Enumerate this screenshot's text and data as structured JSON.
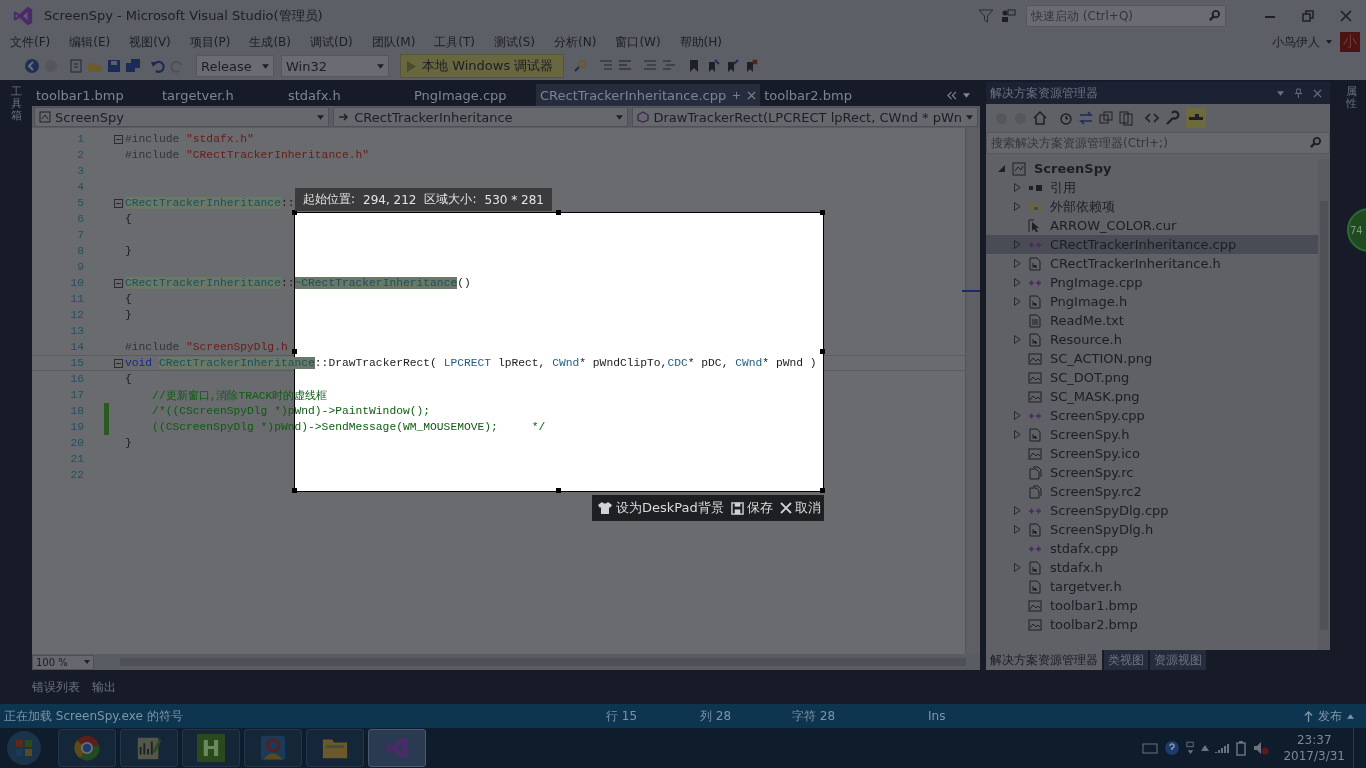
{
  "window": {
    "title": "ScreenSpy - Microsoft Visual Studio(管理员)",
    "quick_launch": {
      "placeholder": "快速启动 (Ctrl+Q)"
    },
    "user": "小鸟伊人",
    "avatar": "小"
  },
  "menu": [
    "文件(F)",
    "编辑(E)",
    "视图(V)",
    "项目(P)",
    "生成(B)",
    "调试(D)",
    "团队(M)",
    "工具(T)",
    "测试(S)",
    "分析(N)",
    "窗口(W)",
    "帮助(H)"
  ],
  "toolbar": {
    "configuration": "Release",
    "platform": "Win32",
    "debugger": "本地 Windows 调试器"
  },
  "left_strip": "工具箱",
  "right_strip": "属性",
  "tabs": [
    {
      "label": "toolbar1.bmp",
      "selected": false
    },
    {
      "label": "targetver.h",
      "selected": false
    },
    {
      "label": "stdafx.h",
      "selected": false
    },
    {
      "label": "PngImage.cpp",
      "selected": false
    },
    {
      "label": "CRectTrackerInheritance.cpp",
      "selected": true
    },
    {
      "label": "toolbar2.bmp",
      "selected": false
    }
  ],
  "nav": [
    "ScreenSpy",
    "CRectTrackerInheritance",
    "DrawTrackerRect(LPCRECT lpRect, CWnd * pWn"
  ],
  "code": [
    {
      "n": "1",
      "fold": true,
      "changed": false,
      "current": false,
      "segs": [
        {
          "kind": "pp",
          "text": "#include "
        },
        {
          "kind": "str",
          "text": "\"stdafx.h\""
        }
      ]
    },
    {
      "n": "2",
      "fold": false,
      "changed": false,
      "current": false,
      "segs": [
        {
          "kind": "pp",
          "text": "#include "
        },
        {
          "kind": "str",
          "text": "\"CRectTrackerInheritance.h\""
        }
      ]
    },
    {
      "n": "3",
      "fold": false,
      "changed": false,
      "current": false
    },
    {
      "n": "4",
      "fold": false,
      "changed": false,
      "current": false
    },
    {
      "n": "5",
      "fold": true,
      "changed": false,
      "current": false,
      "segs": [
        {
          "kind": "ref",
          "text": "CRectTrackerInheritance"
        },
        {
          "kind": "plain",
          "text": "::"
        }
      ]
    },
    {
      "n": "6",
      "fold": false,
      "changed": false,
      "current": false,
      "segs": [
        {
          "kind": "plain",
          "text": "{"
        }
      ]
    },
    {
      "n": "7",
      "fold": false,
      "changed": false,
      "current": false
    },
    {
      "n": "8",
      "fold": false,
      "changed": false,
      "current": false,
      "segs": [
        {
          "kind": "plain",
          "text": "}"
        }
      ]
    },
    {
      "n": "9",
      "fold": false,
      "changed": false,
      "current": false
    },
    {
      "n": "10",
      "fold": true,
      "changed": false,
      "current": false,
      "segs": [
        {
          "kind": "ref",
          "text": "CRectTrackerInheritance"
        },
        {
          "kind": "plain",
          "text": "::"
        },
        {
          "kind": "ref",
          "text": "~CRectTrackerInheritance"
        },
        {
          "kind": "plain",
          "text": "()"
        }
      ]
    },
    {
      "n": "11",
      "fold": false,
      "changed": false,
      "current": false,
      "segs": [
        {
          "kind": "plain",
          "text": "{"
        }
      ]
    },
    {
      "n": "12",
      "fold": false,
      "changed": false,
      "current": false,
      "segs": [
        {
          "kind": "plain",
          "text": "}"
        }
      ]
    },
    {
      "n": "13",
      "fold": false,
      "changed": false,
      "current": false
    },
    {
      "n": "14",
      "fold": false,
      "changed": false,
      "current": false,
      "segs": [
        {
          "kind": "pp",
          "text": "#include "
        },
        {
          "kind": "str",
          "text": "\"ScreenSpyDlg.h"
        }
      ]
    },
    {
      "n": "15",
      "fold": true,
      "changed": false,
      "current": true,
      "segs": [
        {
          "kind": "kw",
          "text": "void "
        },
        {
          "kind": "ref",
          "text": "CRectTrackerInheritance"
        },
        {
          "kind": "plain",
          "text": "::DrawTrackerRect( "
        },
        {
          "kind": "type",
          "text": "LPCRECT"
        },
        {
          "kind": "plain",
          "text": " lpRect, "
        },
        {
          "kind": "type",
          "text": "CWnd"
        },
        {
          "kind": "plain",
          "text": "* pWndClipTo,"
        },
        {
          "kind": "type",
          "text": "CDC"
        },
        {
          "kind": "plain",
          "text": "* pDC, "
        },
        {
          "kind": "type",
          "text": "CWnd"
        },
        {
          "kind": "plain",
          "text": "* pWnd )"
        }
      ]
    },
    {
      "n": "16",
      "fold": false,
      "changed": false,
      "current": false,
      "segs": [
        {
          "kind": "plain",
          "text": "{"
        }
      ]
    },
    {
      "n": "17",
      "fold": false,
      "changed": false,
      "current": false,
      "segs": [
        {
          "kind": "cm",
          "text": "    //更新窗口,消除TRACK时的虚线框"
        }
      ]
    },
    {
      "n": "18",
      "fold": false,
      "changed": true,
      "current": false,
      "segs": [
        {
          "kind": "cm",
          "text": "    /*((CScreenSpyDlg *)pWnd)->PaintWindow();"
        }
      ]
    },
    {
      "n": "19",
      "fold": false,
      "changed": true,
      "current": false,
      "segs": [
        {
          "kind": "cm",
          "text": "    ((CScreenSpyDlg *)pWnd)->SendMessage(WM_MOUSEMOVE);     */"
        }
      ]
    },
    {
      "n": "20",
      "fold": false,
      "changed": false,
      "current": false,
      "segs": [
        {
          "kind": "plain",
          "text": "}"
        }
      ]
    },
    {
      "n": "21",
      "fold": false,
      "changed": false,
      "current": false
    },
    {
      "n": "22",
      "fold": false,
      "changed": false,
      "current": false
    }
  ],
  "capture": {
    "start_label": "起始位置:",
    "start": "294, 212",
    "size_label": "区域大小:",
    "size": "530 * 281",
    "actions": [
      {
        "kind": "wallpaper",
        "label": "设为DeskPad背景"
      },
      {
        "kind": "save",
        "label": "保存"
      },
      {
        "kind": "cancel",
        "label": "取消"
      }
    ]
  },
  "zoom": "100 %",
  "solution_explorer": {
    "title": "解决方案资源管理器",
    "search": {
      "placeholder": "搜索解决方案资源管理器(Ctrl+;)"
    },
    "root": {
      "label": "ScreenSpy",
      "expanded": true
    },
    "items": [
      {
        "label": "引用",
        "kind": "ref",
        "expandable": true,
        "selected": false
      },
      {
        "label": "外部依赖项",
        "kind": "deps",
        "expandable": true,
        "selected": false
      },
      {
        "label": "ARROW_COLOR.cur",
        "kind": "cursor",
        "expandable": false,
        "selected": false
      },
      {
        "label": "CRectTrackerInheritance.cpp",
        "kind": "cpp",
        "expandable": true,
        "selected": true
      },
      {
        "label": "CRectTrackerInheritance.h",
        "kind": "h",
        "expandable": true,
        "selected": false
      },
      {
        "label": "PngImage.cpp",
        "kind": "cpp",
        "expandable": true,
        "selected": false
      },
      {
        "label": "PngImage.h",
        "kind": "h",
        "expandable": true,
        "selected": false
      },
      {
        "label": "ReadMe.txt",
        "kind": "txt",
        "expandable": false,
        "selected": false
      },
      {
        "label": "Resource.h",
        "kind": "h",
        "expandable": true,
        "selected": false
      },
      {
        "label": "SC_ACTION.png",
        "kind": "image",
        "expandable": false,
        "selected": false
      },
      {
        "label": "SC_DOT.png",
        "kind": "image",
        "expandable": false,
        "selected": false
      },
      {
        "label": "SC_MASK.png",
        "kind": "image",
        "expandable": false,
        "selected": false
      },
      {
        "label": "ScreenSpy.cpp",
        "kind": "cpp",
        "expandable": true,
        "selected": false
      },
      {
        "label": "ScreenSpy.h",
        "kind": "h",
        "expandable": true,
        "selected": false
      },
      {
        "label": "ScreenSpy.ico",
        "kind": "image",
        "expandable": false,
        "selected": false
      },
      {
        "label": "ScreenSpy.rc",
        "kind": "rc",
        "expandable": false,
        "selected": false
      },
      {
        "label": "ScreenSpy.rc2",
        "kind": "rc",
        "expandable": false,
        "selected": false
      },
      {
        "label": "ScreenSpyDlg.cpp",
        "kind": "cpp",
        "expandable": true,
        "selected": false
      },
      {
        "label": "ScreenSpyDlg.h",
        "kind": "h",
        "expandable": true,
        "selected": false
      },
      {
        "label": "stdafx.cpp",
        "kind": "cpp",
        "expandable": false,
        "selected": false
      },
      {
        "label": "stdafx.h",
        "kind": "h",
        "expandable": true,
        "selected": false
      },
      {
        "label": "targetver.h",
        "kind": "h",
        "expandable": false,
        "selected": false
      },
      {
        "label": "toolbar1.bmp",
        "kind": "image",
        "expandable": false,
        "selected": false
      },
      {
        "label": "toolbar2.bmp",
        "kind": "image",
        "expandable": false,
        "selected": false
      }
    ],
    "tabs": [
      {
        "label": "解决方案资源管理器",
        "selected": true
      },
      {
        "label": "类视图",
        "selected": false
      },
      {
        "label": "资源视图",
        "selected": false
      }
    ]
  },
  "bottom_tabs": [
    "错误列表",
    "输出"
  ],
  "status": {
    "message": "正在加载 ScreenSpy.exe 的符号",
    "line": "行 15",
    "col": "列 28",
    "char": "字符 28",
    "mode": "Ins",
    "publish": "发布"
  },
  "badge": "74",
  "taskbar": {
    "apps": [
      {
        "kind": "browser",
        "selected": false
      },
      {
        "kind": "editor",
        "selected": false
      },
      {
        "kind": "letter",
        "label": "H",
        "selected": false
      },
      {
        "kind": "person",
        "selected": false
      },
      {
        "kind": "folder",
        "selected": false
      },
      {
        "kind": "vs",
        "selected": true
      }
    ],
    "time": "23:37",
    "date": "2017/3/31"
  }
}
